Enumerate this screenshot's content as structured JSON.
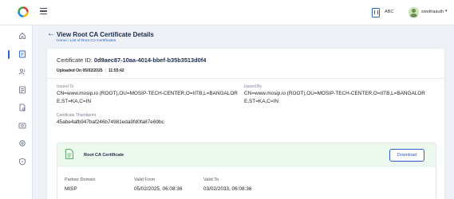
{
  "header": {
    "partner_label": "ABC",
    "user_name": "swethaauth",
    "user_chevron": "▾"
  },
  "sidebar": {
    "items": [
      {
        "name": "home-icon"
      },
      {
        "name": "certificate-icon",
        "active": true
      },
      {
        "name": "users-icon"
      },
      {
        "name": "policy-icon"
      },
      {
        "name": "file-settings-icon"
      },
      {
        "name": "device-icon"
      },
      {
        "name": "settings-icon"
      },
      {
        "name": "shield-icon"
      }
    ]
  },
  "page": {
    "back_arrow": "←",
    "title": "View Root CA Certificate Details",
    "breadcrumb": "Home / List of Root CA Certificates"
  },
  "certificate": {
    "id_label": "Certificate ID:",
    "id_value": "0d9aec87-10aa-4014-bbef-b35b3513d0f4",
    "uploaded_label": "Uploaded On 05/02/2025",
    "uploaded_time": "11:55:42",
    "issued_to_label": "Issued To",
    "issued_to_value": "CN=www.mosip.io (ROOT),OU=MOSIP-TECH-CENTER,O=IITB,L=BANGALORE,ST=KA,C=IN",
    "issued_by_label": "Issued By",
    "issued_by_value": "CN=www.mosip.io (ROOT),OU=MOSIP-TECH-CENTER,O=IITB,L=BANGALORE,ST=KA,C=IN",
    "thumbprint_label": "Certificate Thumbprint",
    "thumbprint_value": "45abe4afb947baf246b74981eda9fd0fa87e69bc"
  },
  "cert_box": {
    "title": "Root CA Certificate",
    "download_label": "Download",
    "partner_domain_label": "Partner Domain",
    "partner_domain_value": "MISP",
    "valid_from_label": "Valid From",
    "valid_from_value": "05/02/2025, 06:08:36",
    "valid_to_label": "Valid To",
    "valid_to_value": "03/02/2033, 06:08:36"
  },
  "colors": {
    "accent": "#2b60c8",
    "title": "#1a2b4c",
    "success_bg": "#edf8ee",
    "page_bg": "#eef1f6"
  }
}
